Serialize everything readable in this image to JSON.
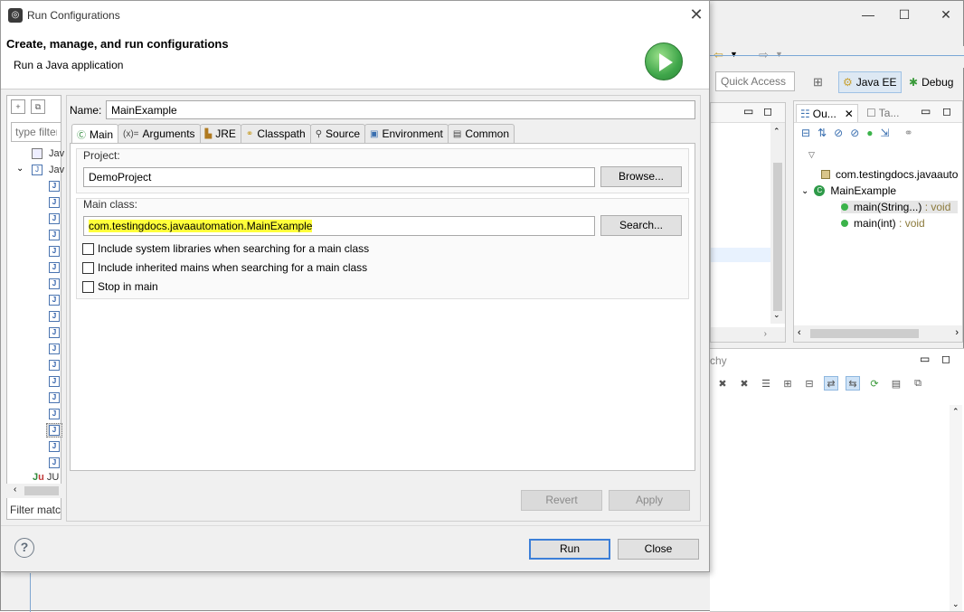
{
  "background": {
    "window_controls": {
      "minimize": "—",
      "maximize": "☐",
      "close": "✕"
    },
    "quick_access": {
      "placeholder": "Quick Access"
    },
    "perspectives": [
      {
        "label": "Java EE",
        "active": true
      },
      {
        "label": "Debug",
        "active": false
      }
    ],
    "outline": {
      "tabs": [
        "Ou...",
        "Ta..."
      ],
      "rows": [
        {
          "label": "com.testingdocs.javaauto"
        },
        {
          "label": "MainExample"
        },
        {
          "label": "main(String...)",
          "type": " : void",
          "selected": true
        },
        {
          "label": "main(int)",
          "type": " : void",
          "selected": false
        }
      ]
    },
    "hierarchy": {
      "tab_fragment": "chy"
    }
  },
  "dialog": {
    "title": "Run Configurations",
    "heading": "Create, manage, and run configurations",
    "subheading": "Run a Java application",
    "tree": {
      "filter_placeholder": "type filter",
      "rows": [
        "Jav",
        "Jav"
      ],
      "junit_label": "JU",
      "filter_status": "Filter matc"
    },
    "name_label": "Name:",
    "name_value": "MainExample",
    "tabs": [
      {
        "icon": "main-class-icon",
        "label": "Main",
        "active": true
      },
      {
        "icon": "arguments-icon",
        "label": "Arguments",
        "prefix": "(x)="
      },
      {
        "icon": "jre-icon",
        "label": "JRE"
      },
      {
        "icon": "classpath-icon",
        "label": "Classpath"
      },
      {
        "icon": "source-icon",
        "label": "Source"
      },
      {
        "icon": "environment-icon",
        "label": "Environment"
      },
      {
        "icon": "common-icon",
        "label": "Common"
      }
    ],
    "project": {
      "label": "Project:",
      "value": "DemoProject",
      "button": "Browse..."
    },
    "main_class": {
      "label": "Main class:",
      "value": "com.testingdocs.javaautomation.MainExample",
      "button": "Search..."
    },
    "options": [
      {
        "label": "Include system libraries when searching for a main class",
        "checked": false
      },
      {
        "label": "Include inherited mains when searching for a main class",
        "checked": false
      },
      {
        "label": "Stop in main",
        "checked": false
      }
    ],
    "revert_label": "Revert",
    "apply_label": "Apply",
    "run_label": "Run",
    "close_label": "Close",
    "accent_color": "#ffff3a"
  }
}
